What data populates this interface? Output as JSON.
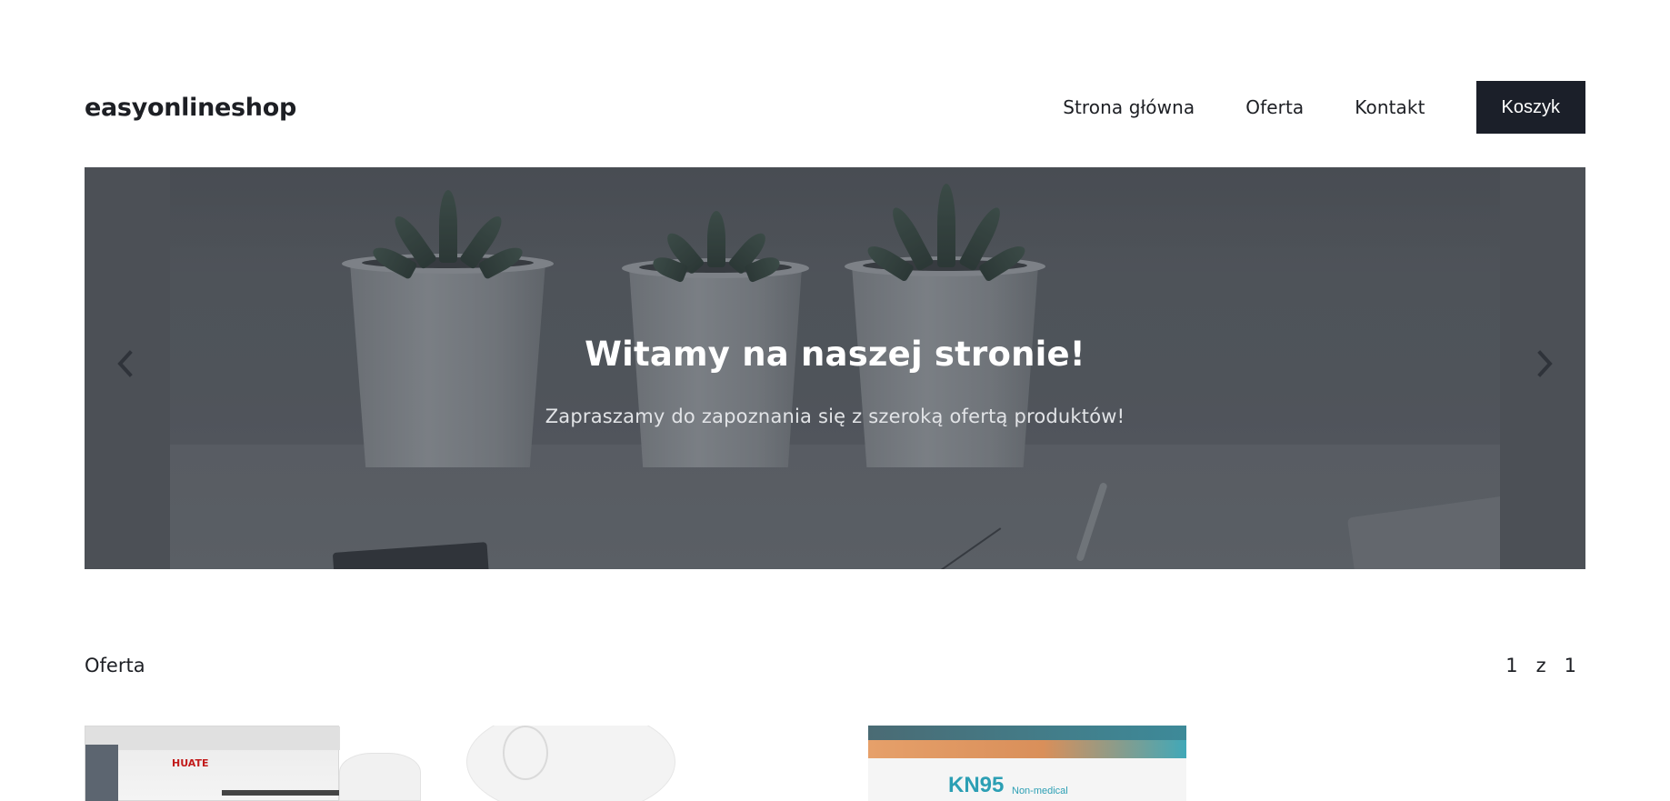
{
  "header": {
    "logo": "easyonlineshop",
    "nav": [
      {
        "label": "Strona główna"
      },
      {
        "label": "Oferta"
      },
      {
        "label": "Kontakt"
      }
    ],
    "cart_label": "Koszyk"
  },
  "hero": {
    "title": "Witamy na naszej stronie!",
    "subtitle": "Zapraszamy do zapoznania się z szeroką ofertą produktów!",
    "prev_icon": "chevron-left-icon",
    "next_icon": "chevron-right-icon"
  },
  "offer": {
    "title": "Oferta",
    "pagination": {
      "current": "1",
      "separator": "z",
      "total": "1"
    }
  },
  "products": [
    {
      "image_text": "HUATE"
    },
    {
      "image_text": ""
    },
    {
      "image_text": "KN95",
      "image_subtext": "Non-medical"
    }
  ],
  "colors": {
    "accent": "#1b1f29",
    "text": "#1d1f24",
    "background": "#ffffff"
  }
}
